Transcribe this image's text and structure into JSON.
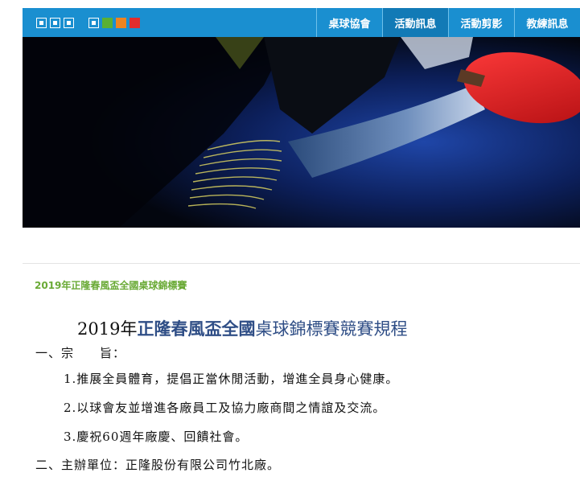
{
  "toolbar": {
    "icons": [
      "fullscreen-icon",
      "window-icon",
      "resize-icon",
      "layout-icon"
    ],
    "theme_colors": [
      "#5ab034",
      "#ee8420",
      "#e22d2d"
    ],
    "bar_color": "#1a8fd0"
  },
  "nav": {
    "items": [
      {
        "label": "桌球協會"
      },
      {
        "label": "活動訊息"
      },
      {
        "label": "活動剪影"
      },
      {
        "label": "教練訊息"
      }
    ],
    "active_index": 1
  },
  "breadcrumb": "2019年正隆春風盃全國桌球錦標賽",
  "article": {
    "title_year": "2019年",
    "title_highlight": "正隆春風盃全國",
    "title_rest": "桌球錦標賽競賽規程",
    "section1_heading": "一、宗　　旨：",
    "items": [
      "1.推展全員體育，提倡正當休閒活動，增進全員身心健康。",
      "2.以球會友並增進各廠員工及協力廠商間之情誼及交流。",
      "3.慶祝60週年廠慶、回饋社會。"
    ],
    "section2": "二、主辦單位：正隆股份有限公司竹北廠。"
  }
}
